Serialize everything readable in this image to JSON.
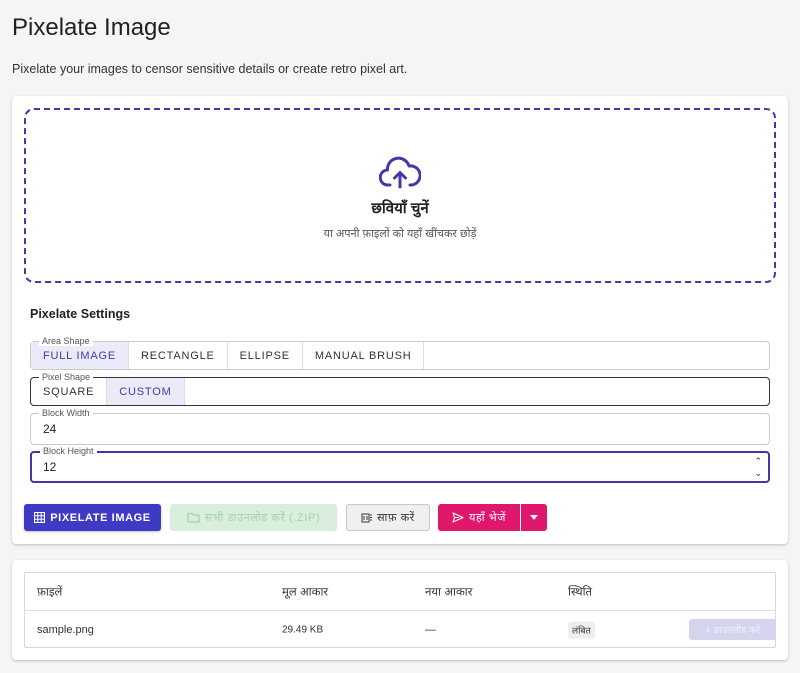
{
  "header": {
    "title": "Pixelate Image",
    "subtitle": "Pixelate your images to censor sensitive details or create retro pixel art."
  },
  "dropzone": {
    "icon": "cloud-upload-icon",
    "title": "छवियाँ चुनें",
    "subtitle": "या अपनी फ़ाइलों को यहाँ खींचकर छोड़ें"
  },
  "settings": {
    "title": "Pixelate Settings",
    "area_shape": {
      "legend": "Area Shape",
      "options": [
        "FULL IMAGE",
        "RECTANGLE",
        "ELLIPSE",
        "MANUAL BRUSH"
      ],
      "selected": "FULL IMAGE"
    },
    "pixel_shape": {
      "legend": "Pixel Shape",
      "options": [
        "SQUARE",
        "CUSTOM"
      ],
      "selected": "CUSTOM"
    },
    "block_width": {
      "legend": "Block Width",
      "value": "24"
    },
    "block_height": {
      "legend": "Block Height",
      "value": "12"
    }
  },
  "actions": {
    "pixelate": "PIXELATE IMAGE",
    "download_all": "सभी डाउनलोड करें (.ZIP)",
    "clear": "साफ़ करें",
    "send_here": "यहाँ भेजें"
  },
  "files_table": {
    "headers": [
      "फ़ाइलें",
      "मूल आकार",
      "नया आकार",
      "स्थिति"
    ],
    "rows": [
      {
        "name": "sample.png",
        "original_size": "29.49 KB",
        "new_size": "—",
        "status": "लंबित",
        "download": "डाउनलोड करें"
      }
    ]
  },
  "colors": {
    "accent": "#3f3ac4",
    "send": "#e0186c",
    "download_disabled": "#d9eedd"
  }
}
